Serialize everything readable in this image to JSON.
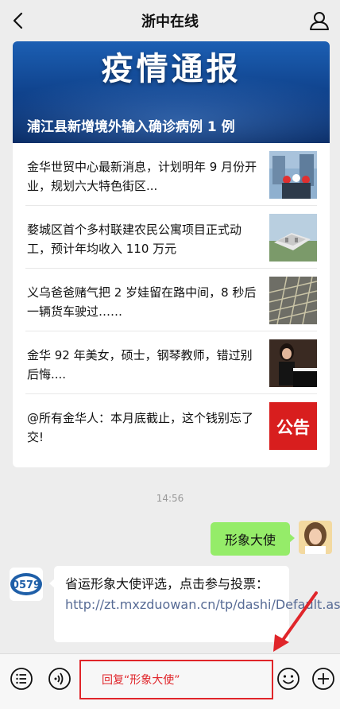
{
  "header": {
    "title": "浙中在线"
  },
  "banner": {
    "headline": "疫情通报",
    "subtitle": "浦江县新增境外输入确诊病例 1 例"
  },
  "news": [
    {
      "title": "金华世贸中心最新消息，计划明年 9 月份开业，规划六大特色街区..."
    },
    {
      "title": "婺城区首个多村联建农民公寓项目正式动工，预计年均收入 110 万元"
    },
    {
      "title": "义乌爸爸赌气把 2 岁娃留在路中间，8 秒后一辆货车驶过……"
    },
    {
      "title": "金华 92 年美女，硕士，钢琴教师，错过别后悔...."
    },
    {
      "title": "@所有金华人：本月底截止，这个钱别忘了交!"
    }
  ],
  "notice_thumb_text": "公告",
  "chat": {
    "time": "14:56",
    "outgoing": "形象大使",
    "incoming_text": "省运形象大使评选，点击参与投票：",
    "incoming_link": "http://zt.mxzduowan.cn/tp/dashi/Default.aspx",
    "bot_avatar_text": "0579"
  },
  "bottombar": {
    "reply_label": "回复“形象大使”"
  },
  "colors": {
    "accent_red": "#e0252a",
    "bubble_green": "#95ec69",
    "link": "#576b95"
  }
}
